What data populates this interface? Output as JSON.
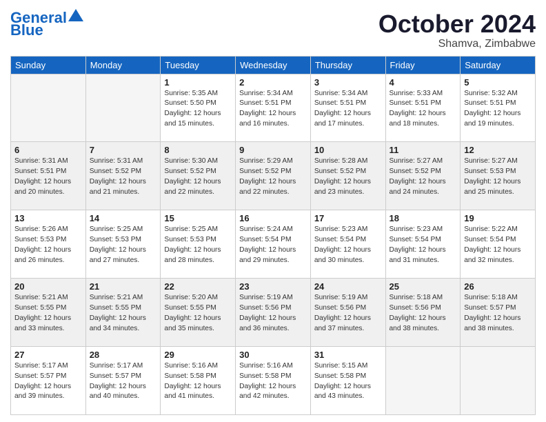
{
  "header": {
    "logo_line1": "General",
    "logo_line2": "Blue",
    "month": "October 2024",
    "location": "Shamva, Zimbabwe"
  },
  "days_of_week": [
    "Sunday",
    "Monday",
    "Tuesday",
    "Wednesday",
    "Thursday",
    "Friday",
    "Saturday"
  ],
  "weeks": [
    [
      {
        "day": "",
        "empty": true
      },
      {
        "day": "",
        "empty": true
      },
      {
        "day": "1",
        "sunrise": "5:35 AM",
        "sunset": "5:50 PM",
        "daylight": "12 hours and 15 minutes."
      },
      {
        "day": "2",
        "sunrise": "5:34 AM",
        "sunset": "5:51 PM",
        "daylight": "12 hours and 16 minutes."
      },
      {
        "day": "3",
        "sunrise": "5:34 AM",
        "sunset": "5:51 PM",
        "daylight": "12 hours and 17 minutes."
      },
      {
        "day": "4",
        "sunrise": "5:33 AM",
        "sunset": "5:51 PM",
        "daylight": "12 hours and 18 minutes."
      },
      {
        "day": "5",
        "sunrise": "5:32 AM",
        "sunset": "5:51 PM",
        "daylight": "12 hours and 19 minutes."
      }
    ],
    [
      {
        "day": "6",
        "sunrise": "5:31 AM",
        "sunset": "5:51 PM",
        "daylight": "12 hours and 20 minutes."
      },
      {
        "day": "7",
        "sunrise": "5:31 AM",
        "sunset": "5:52 PM",
        "daylight": "12 hours and 21 minutes."
      },
      {
        "day": "8",
        "sunrise": "5:30 AM",
        "sunset": "5:52 PM",
        "daylight": "12 hours and 22 minutes."
      },
      {
        "day": "9",
        "sunrise": "5:29 AM",
        "sunset": "5:52 PM",
        "daylight": "12 hours and 22 minutes."
      },
      {
        "day": "10",
        "sunrise": "5:28 AM",
        "sunset": "5:52 PM",
        "daylight": "12 hours and 23 minutes."
      },
      {
        "day": "11",
        "sunrise": "5:27 AM",
        "sunset": "5:52 PM",
        "daylight": "12 hours and 24 minutes."
      },
      {
        "day": "12",
        "sunrise": "5:27 AM",
        "sunset": "5:53 PM",
        "daylight": "12 hours and 25 minutes."
      }
    ],
    [
      {
        "day": "13",
        "sunrise": "5:26 AM",
        "sunset": "5:53 PM",
        "daylight": "12 hours and 26 minutes."
      },
      {
        "day": "14",
        "sunrise": "5:25 AM",
        "sunset": "5:53 PM",
        "daylight": "12 hours and 27 minutes."
      },
      {
        "day": "15",
        "sunrise": "5:25 AM",
        "sunset": "5:53 PM",
        "daylight": "12 hours and 28 minutes."
      },
      {
        "day": "16",
        "sunrise": "5:24 AM",
        "sunset": "5:54 PM",
        "daylight": "12 hours and 29 minutes."
      },
      {
        "day": "17",
        "sunrise": "5:23 AM",
        "sunset": "5:54 PM",
        "daylight": "12 hours and 30 minutes."
      },
      {
        "day": "18",
        "sunrise": "5:23 AM",
        "sunset": "5:54 PM",
        "daylight": "12 hours and 31 minutes."
      },
      {
        "day": "19",
        "sunrise": "5:22 AM",
        "sunset": "5:54 PM",
        "daylight": "12 hours and 32 minutes."
      }
    ],
    [
      {
        "day": "20",
        "sunrise": "5:21 AM",
        "sunset": "5:55 PM",
        "daylight": "12 hours and 33 minutes."
      },
      {
        "day": "21",
        "sunrise": "5:21 AM",
        "sunset": "5:55 PM",
        "daylight": "12 hours and 34 minutes."
      },
      {
        "day": "22",
        "sunrise": "5:20 AM",
        "sunset": "5:55 PM",
        "daylight": "12 hours and 35 minutes."
      },
      {
        "day": "23",
        "sunrise": "5:19 AM",
        "sunset": "5:56 PM",
        "daylight": "12 hours and 36 minutes."
      },
      {
        "day": "24",
        "sunrise": "5:19 AM",
        "sunset": "5:56 PM",
        "daylight": "12 hours and 37 minutes."
      },
      {
        "day": "25",
        "sunrise": "5:18 AM",
        "sunset": "5:56 PM",
        "daylight": "12 hours and 38 minutes."
      },
      {
        "day": "26",
        "sunrise": "5:18 AM",
        "sunset": "5:57 PM",
        "daylight": "12 hours and 38 minutes."
      }
    ],
    [
      {
        "day": "27",
        "sunrise": "5:17 AM",
        "sunset": "5:57 PM",
        "daylight": "12 hours and 39 minutes."
      },
      {
        "day": "28",
        "sunrise": "5:17 AM",
        "sunset": "5:57 PM",
        "daylight": "12 hours and 40 minutes."
      },
      {
        "day": "29",
        "sunrise": "5:16 AM",
        "sunset": "5:58 PM",
        "daylight": "12 hours and 41 minutes."
      },
      {
        "day": "30",
        "sunrise": "5:16 AM",
        "sunset": "5:58 PM",
        "daylight": "12 hours and 42 minutes."
      },
      {
        "day": "31",
        "sunrise": "5:15 AM",
        "sunset": "5:58 PM",
        "daylight": "12 hours and 43 minutes."
      },
      {
        "day": "",
        "empty": true
      },
      {
        "day": "",
        "empty": true
      }
    ]
  ],
  "labels": {
    "sunrise": "Sunrise:",
    "sunset": "Sunset:",
    "daylight": "Daylight:"
  }
}
